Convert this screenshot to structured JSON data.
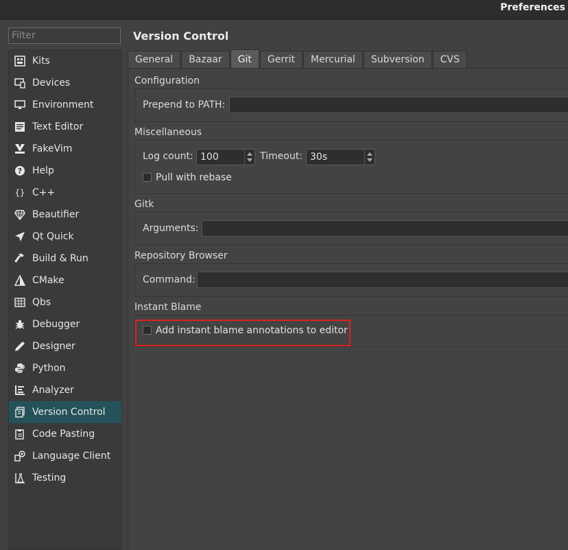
{
  "window": {
    "title": "Preferences"
  },
  "filter": {
    "placeholder": "Filter",
    "value": ""
  },
  "sidebar": {
    "items": [
      {
        "label": "Kits",
        "icon": "kits-icon"
      },
      {
        "label": "Devices",
        "icon": "devices-icon"
      },
      {
        "label": "Environment",
        "icon": "monitor-icon"
      },
      {
        "label": "Text Editor",
        "icon": "text-editor-icon"
      },
      {
        "label": "FakeVim",
        "icon": "fakevim-icon"
      },
      {
        "label": "Help",
        "icon": "help-icon"
      },
      {
        "label": "C++",
        "icon": "braces-icon"
      },
      {
        "label": "Beautifier",
        "icon": "diamond-icon"
      },
      {
        "label": "Qt Quick",
        "icon": "qtquick-icon"
      },
      {
        "label": "Build & Run",
        "icon": "hammer-icon"
      },
      {
        "label": "CMake",
        "icon": "cmake-icon"
      },
      {
        "label": "Qbs",
        "icon": "qbs-icon"
      },
      {
        "label": "Debugger",
        "icon": "bug-icon"
      },
      {
        "label": "Designer",
        "icon": "pen-icon"
      },
      {
        "label": "Python",
        "icon": "python-icon"
      },
      {
        "label": "Analyzer",
        "icon": "analyzer-icon"
      },
      {
        "label": "Version Control",
        "icon": "version-control-icon"
      },
      {
        "label": "Code Pasting",
        "icon": "paste-icon"
      },
      {
        "label": "Language Client",
        "icon": "language-client-icon"
      },
      {
        "label": "Testing",
        "icon": "testing-icon"
      }
    ],
    "active_index": 16
  },
  "main": {
    "title": "Version Control",
    "tabs": [
      {
        "label": "General"
      },
      {
        "label": "Bazaar"
      },
      {
        "label": "Git"
      },
      {
        "label": "Gerrit"
      },
      {
        "label": "Mercurial"
      },
      {
        "label": "Subversion"
      },
      {
        "label": "CVS"
      }
    ],
    "active_tab": "Git",
    "configuration": {
      "title": "Configuration",
      "prepend_label": "Prepend to PATH:",
      "prepend_value": ""
    },
    "misc": {
      "title": "Miscellaneous",
      "log_count_label": "Log count:",
      "log_count_value": "100",
      "timeout_label": "Timeout:",
      "timeout_value": "30s",
      "pull_rebase_label": "Pull with rebase",
      "pull_rebase_checked": false
    },
    "gitk": {
      "title": "Gitk",
      "arguments_label": "Arguments:",
      "arguments_value": ""
    },
    "repo_browser": {
      "title": "Repository Browser",
      "command_label": "Command:",
      "command_value": ""
    },
    "instant_blame": {
      "title": "Instant Blame",
      "annotations_label": "Add instant blame annotations to editor",
      "annotations_checked": false
    }
  },
  "colors": {
    "highlight": "#e02020",
    "active_item": "#25525a"
  }
}
